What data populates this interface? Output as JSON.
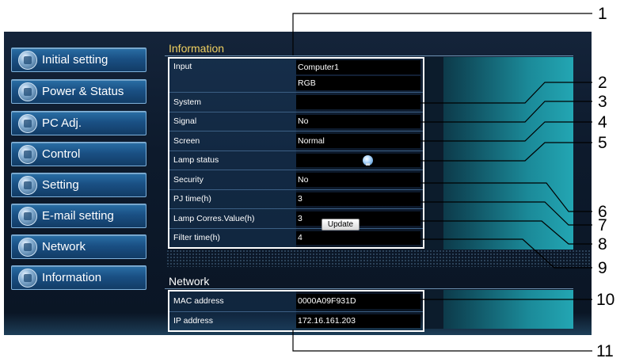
{
  "sidebar": {
    "items": [
      {
        "label": "Initial setting",
        "icon": "wrench-gear-icon"
      },
      {
        "label": "Power & Status",
        "icon": "power-icon"
      },
      {
        "label": "PC Adj.",
        "icon": "monitor-icon"
      },
      {
        "label": "Control",
        "icon": "control-icon"
      },
      {
        "label": "Setting",
        "icon": "pencil-icon"
      },
      {
        "label": "E-mail setting",
        "icon": "mail-icon"
      },
      {
        "label": "Network",
        "icon": "network-icon"
      },
      {
        "label": "Information",
        "icon": "info-icon"
      }
    ]
  },
  "information": {
    "title": "Information",
    "rows": {
      "input": {
        "label": "Input",
        "values": [
          "Computer1",
          "RGB"
        ]
      },
      "system": {
        "label": "System",
        "value": ""
      },
      "signal": {
        "label": "Signal",
        "value": "No"
      },
      "screen": {
        "label": "Screen",
        "value": "Normal"
      },
      "lamp_status": {
        "label": "Lamp status",
        "icon": "lamp-bulb-icon"
      },
      "security": {
        "label": "Security",
        "value": "No"
      },
      "pj_time": {
        "label": "PJ time(h)",
        "value": "3"
      },
      "lamp_corres": {
        "label": "Lamp Corres.Value(h)",
        "value": "3"
      },
      "filter_time": {
        "label": "Filter time(h)",
        "value": "4"
      }
    },
    "update_label": "Update"
  },
  "network": {
    "title": "Network",
    "rows": {
      "mac": {
        "label": "MAC address",
        "value": "0000A09F931D"
      },
      "ip": {
        "label": "IP address",
        "value": "172.16.161.203"
      }
    }
  },
  "callouts": [
    "1",
    "2",
    "3",
    "4",
    "5",
    "6",
    "7",
    "8",
    "9",
    "10",
    "11"
  ],
  "colors": {
    "background": "#0d1a2c",
    "section_title": "#f0d060",
    "button_blue": "#1a5084",
    "panel_teal": "#23a6b3"
  }
}
